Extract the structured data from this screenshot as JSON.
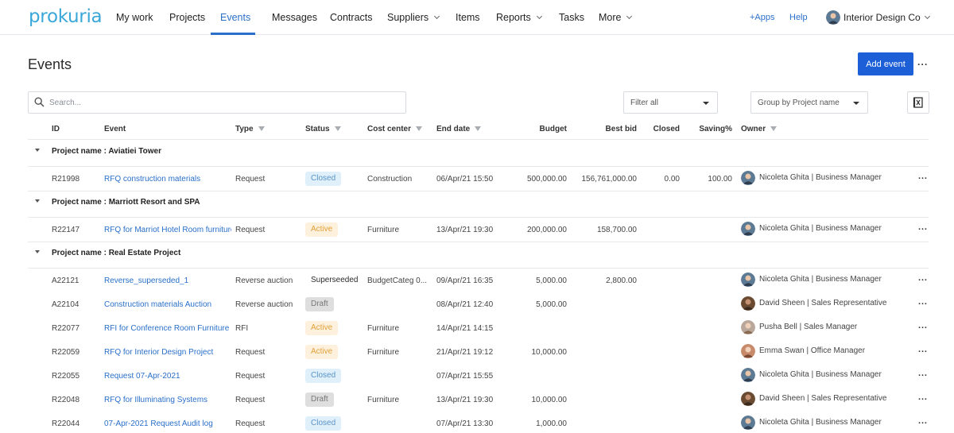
{
  "brand": {
    "logo_text": "prokuria",
    "accent": "#2a6fc9",
    "logo_color": "#3aa7d9",
    "primary_button": "#1c5fd6"
  },
  "nav": {
    "items": [
      {
        "label": "My work"
      },
      {
        "label": "Projects"
      },
      {
        "label": "Events",
        "active": true
      },
      {
        "label": "Messages"
      },
      {
        "label": "Contracts"
      },
      {
        "label": "Suppliers",
        "has_dropdown": true
      },
      {
        "label": "Items"
      },
      {
        "label": "Reports",
        "has_dropdown": true
      },
      {
        "label": "Tasks"
      },
      {
        "label": "More",
        "has_dropdown": true
      }
    ],
    "apps_label": "+Apps",
    "help_label": "Help",
    "account_name": "Interior Design Co"
  },
  "page": {
    "title": "Events",
    "add_button": "Add event",
    "more_icon": "ellipsis-icon"
  },
  "toolbar": {
    "search_placeholder": "Search...",
    "filter_value": "Filter all",
    "group_value": "Group by Project name",
    "export_icon": "excel-icon"
  },
  "table": {
    "columns": {
      "id": "ID",
      "event": "Event",
      "type": "Type",
      "status": "Status",
      "cost_center": "Cost center",
      "end_date": "End date",
      "budget": "Budget",
      "best_bid": "Best bid",
      "closed": "Closed",
      "saving": "Saving%",
      "owner": "Owner"
    },
    "groups": [
      {
        "label": "Project name : Aviatiei Tower",
        "rows": [
          {
            "id": "R21998",
            "event": "RFQ construction materials",
            "type": "Request",
            "status": "Closed",
            "cost_center": "Construction",
            "end_date": "06/Apr/21 15:50",
            "budget": "500,000.00",
            "best_bid": "156,761,000.00",
            "closed": "0.00",
            "saving": "100.00",
            "owner": "Nicoleta Ghita | Business Manager"
          }
        ]
      },
      {
        "label": "Project name : Marriott Resort and SPA",
        "rows": [
          {
            "id": "R22147",
            "event": "RFQ for Marriot Hotel Room furniture",
            "type": "Request",
            "status": "Active",
            "cost_center": "Furniture",
            "end_date": "13/Apr/21 19:30",
            "budget": "200,000.00",
            "best_bid": "158,700.00",
            "closed": "",
            "saving": "",
            "owner": "Nicoleta Ghita | Business Manager"
          }
        ]
      },
      {
        "label": "Project name : Real Estate Project",
        "rows": [
          {
            "id": "A22121",
            "event": "Reverse_superseded_1",
            "type": "Reverse auction",
            "status": "Superseeded",
            "cost_center": "BudgetCateg 0...",
            "end_date": "09/Apr/21 16:35",
            "budget": "5,000.00",
            "best_bid": "2,800.00",
            "closed": "",
            "saving": "",
            "owner": "Nicoleta Ghita | Business Manager"
          },
          {
            "id": "A22104",
            "event": "Construction materials Auction",
            "type": "Reverse auction",
            "status": "Draft",
            "cost_center": "",
            "end_date": "08/Apr/21 12:40",
            "budget": "5,000.00",
            "best_bid": "",
            "closed": "",
            "saving": "",
            "owner": "David Sheen | Sales Representative"
          },
          {
            "id": "R22077",
            "event": "RFI for Conference Room Furniture",
            "type": "RFI",
            "status": "Active",
            "cost_center": "Furniture",
            "end_date": "14/Apr/21 14:15",
            "budget": "",
            "best_bid": "",
            "closed": "",
            "saving": "",
            "owner": "Pusha Bell | Sales Manager"
          },
          {
            "id": "R22059",
            "event": "RFQ for Interior Design Project",
            "type": "Request",
            "status": "Active",
            "cost_center": "Furniture",
            "end_date": "21/Apr/21 19:12",
            "budget": "10,000.00",
            "best_bid": "",
            "closed": "",
            "saving": "",
            "owner": "Emma Swan | Office Manager"
          },
          {
            "id": "R22055",
            "event": "Request 07-Apr-2021",
            "type": "Request",
            "status": "Closed",
            "cost_center": "",
            "end_date": "07/Apr/21 15:55",
            "budget": "",
            "best_bid": "",
            "closed": "",
            "saving": "",
            "owner": "Nicoleta Ghita | Business Manager"
          },
          {
            "id": "R22048",
            "event": "RFQ for Illuminating Systems",
            "type": "Request",
            "status": "Draft",
            "cost_center": "Furniture",
            "end_date": "13/Apr/21 19:30",
            "budget": "10,000.00",
            "best_bid": "",
            "closed": "",
            "saving": "",
            "owner": "David Sheen | Sales Representative"
          },
          {
            "id": "R22044",
            "event": "07-Apr-2021 Request Audit log",
            "type": "Request",
            "status": "Closed",
            "cost_center": "",
            "end_date": "07/Apr/21 13:30",
            "budget": "1,000.00",
            "best_bid": "",
            "closed": "",
            "saving": "",
            "owner": "Nicoleta Ghita | Business Manager"
          }
        ]
      }
    ],
    "status_colors": {
      "Closed": "#5a93c7",
      "Active": "#e2a13a",
      "Superseeded": "#6b44b4",
      "Draft": "#777777"
    }
  }
}
